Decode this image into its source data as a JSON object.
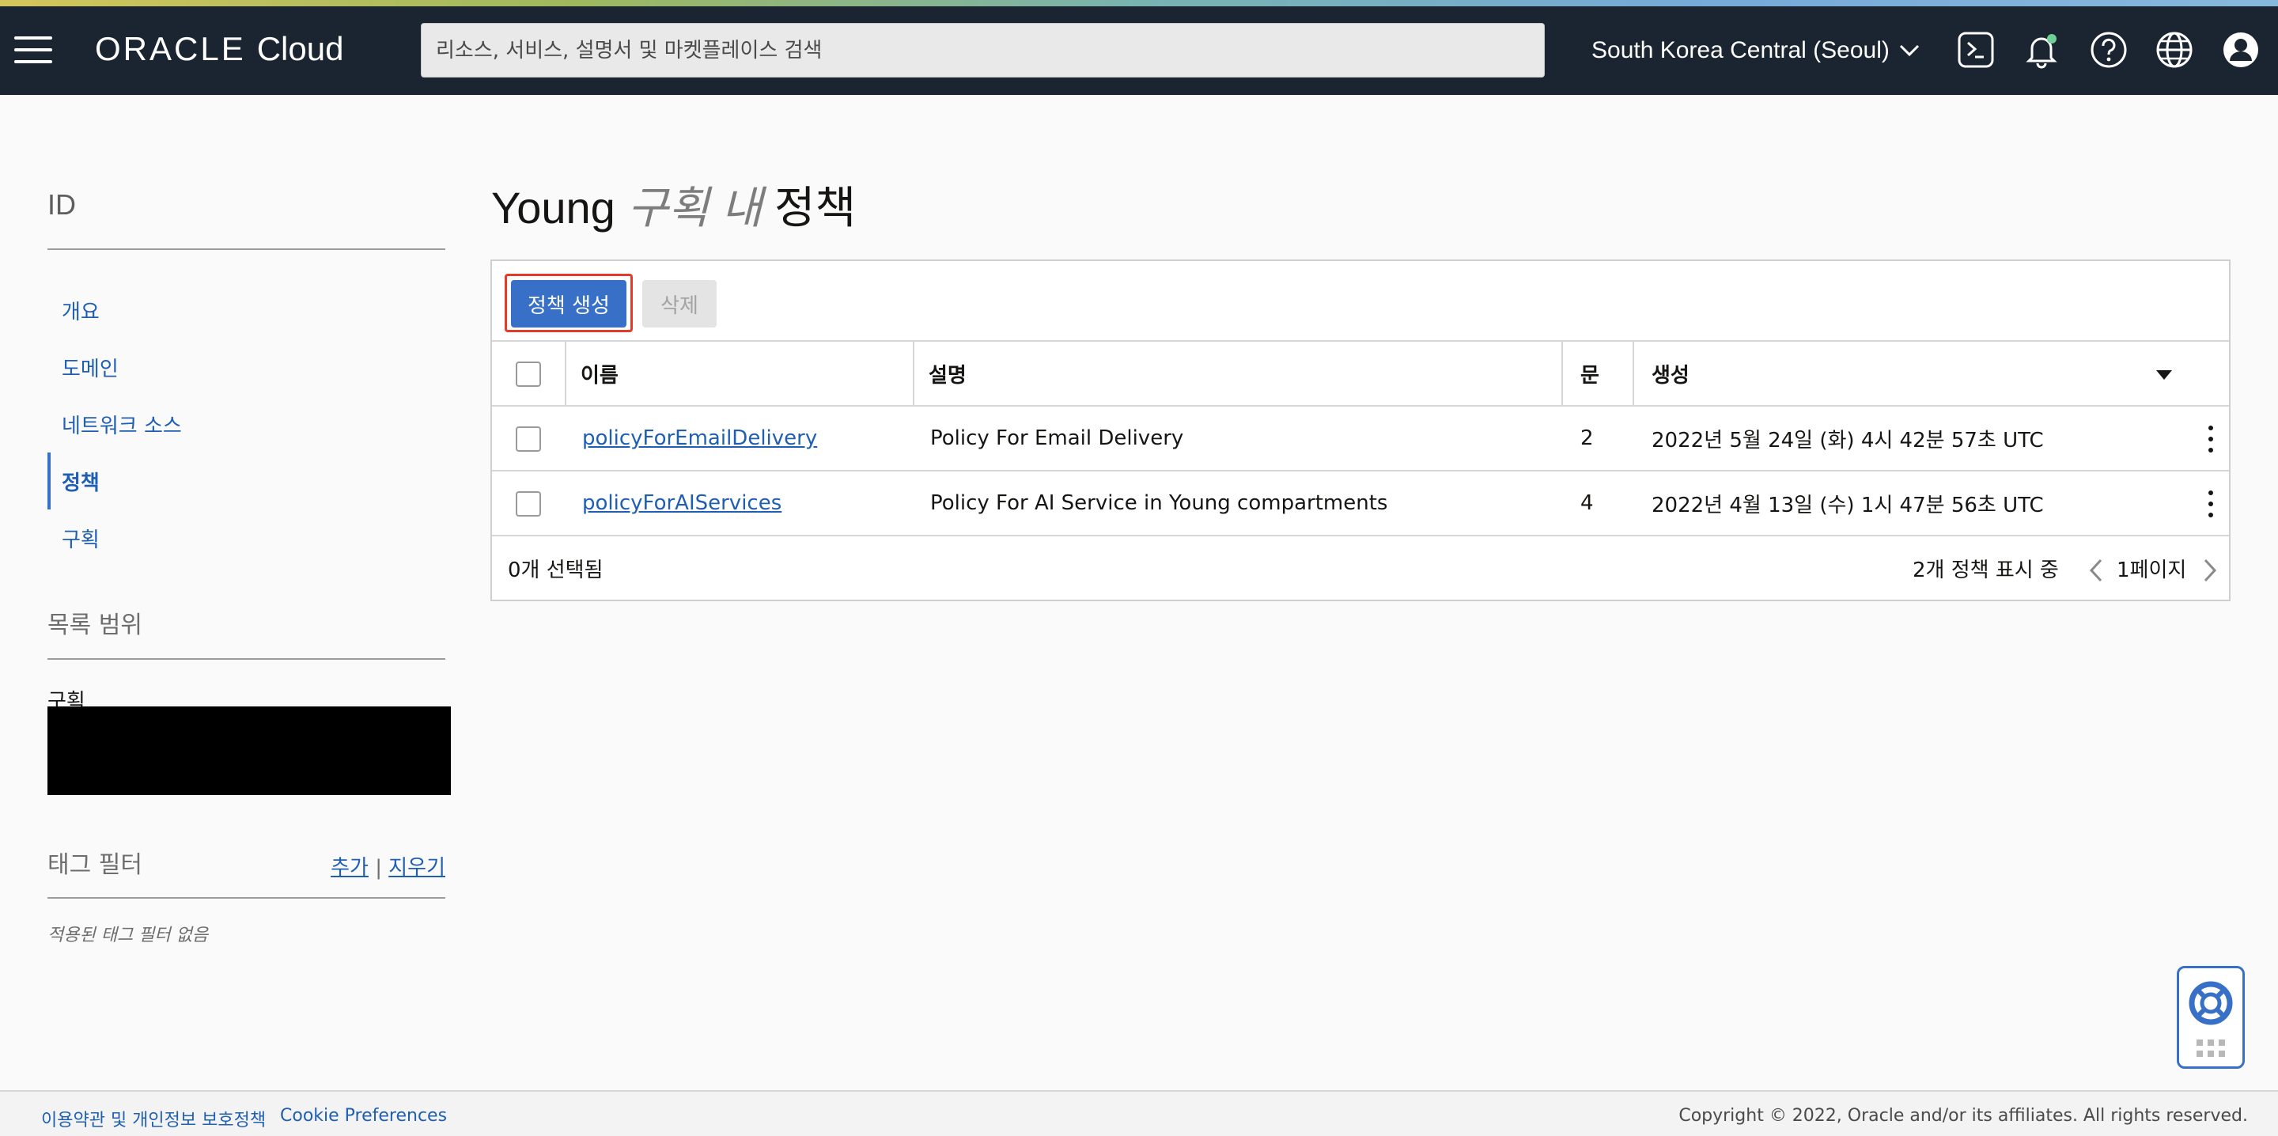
{
  "header": {
    "logo_oracle": "ORACLE",
    "logo_cloud": "Cloud",
    "search_placeholder": "리소스, 서비스, 설명서 및 마켓플레이스 검색",
    "region": "South Korea Central (Seoul)",
    "icons": [
      "menu-icon",
      "cloud-shell-icon",
      "bell-icon",
      "help-icon",
      "globe-icon",
      "user-icon"
    ]
  },
  "sidebar": {
    "title": "ID",
    "items": [
      {
        "label": "개요",
        "active": false
      },
      {
        "label": "도메인",
        "active": false
      },
      {
        "label": "네트워크 소스",
        "active": false
      },
      {
        "label": "정책",
        "active": true
      },
      {
        "label": "구획",
        "active": false
      }
    ],
    "scope_title": "목록 범위",
    "scope_label": "구획",
    "tag_title": "태그 필터",
    "tag_add": "추가",
    "tag_sep": "|",
    "tag_clear": "지우기",
    "tag_empty": "적용된 태그 필터 없음"
  },
  "main": {
    "title_prefix": "Young",
    "title_italic": "구획 내",
    "title_suffix": "정책",
    "create_button": "정책 생성",
    "delete_button": "삭제",
    "columns": {
      "name": "이름",
      "description": "설명",
      "statements": "문",
      "created": "생성"
    },
    "rows": [
      {
        "name": "policyForEmailDelivery",
        "description": "Policy For Email Delivery",
        "statements": "2",
        "created": "2022년 5월 24일 (화) 4시 42분 57초 UTC"
      },
      {
        "name": "policyForAIServices",
        "description": "Policy For AI Service in Young compartments",
        "statements": "4",
        "created": "2022년 4월 13일 (수) 1시 47분 56초 UTC"
      }
    ],
    "selected_count": "0개 선택됨",
    "showing": "2개 정책 표시 중",
    "page": "1페이지"
  },
  "footer": {
    "terms": "이용약관 및 개인정보 보호정책",
    "cookies": "Cookie Preferences",
    "copyright": "Copyright © 2022, Oracle and/or its affiliates. All rights reserved."
  },
  "colors": {
    "header_bg": "#1b2531",
    "accent": "#3870c8",
    "link": "#1f5fb3",
    "highlight": "#e43a2a"
  }
}
